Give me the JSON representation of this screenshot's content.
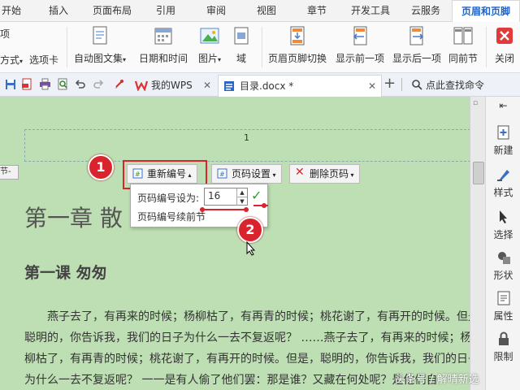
{
  "tabs": [
    "开始",
    "插入",
    "页面布局",
    "引用",
    "审阅",
    "视图",
    "章节",
    "开发工具",
    "云服务",
    "页眉和页脚"
  ],
  "active_tab": "页眉和页脚",
  "ribbon": {
    "left_partial_top": "项",
    "left_partial_bottom": "方式",
    "options_tab": "选项卡",
    "auto_text": "自动图文集",
    "date_time": "日期和时间",
    "picture": "图片",
    "field": "域",
    "switch_header_footer": "页眉页脚切换",
    "show_previous": "显示前一项",
    "show_next": "显示后一项",
    "same_as_previous": "同前节",
    "close": "关闭"
  },
  "quickbar": {
    "wps_tab": "我的WPS",
    "doc_tab": "目录.docx *",
    "search": "点此查找命令"
  },
  "document": {
    "page_number": "1",
    "section_label": "节-",
    "chapter_title": "第一章  散",
    "lesson_title": "第一课  匆匆",
    "para1": "燕子去了，有再来的时候；杨柳枯了，有再青的时候；桃花谢了，有再开的时候。但是",
    "para2": "聪明的，你告诉我，我们的日子为什么一去不复返呢？ ……燕子去了，有再来的时候；杨",
    "para3": "柳枯了，有再青的时候；桃花谢了，有再开的时候。但是，聪明的，你告诉我，我们的日子",
    "para4": "为什么一去不复返呢？ 一一是有人偷了他们罢：那是谁？又藏在何处呢？是他们自"
  },
  "header_toolbar": {
    "renumber": "重新编号",
    "page_settings": "页码设置",
    "delete_page_number": "删除页码"
  },
  "renumber_popup": {
    "label": "页码编号设为:",
    "value": "16",
    "continue_previous": "页码编号续前节"
  },
  "annotations": {
    "badge1": "1",
    "badge2": "2"
  },
  "right_panel": [
    "新建",
    "样式",
    "选择",
    "形状",
    "属性",
    "限制"
  ],
  "watermark": "头条号 / 解晴新选",
  "colors": {
    "doc_bg": "#bddfb3",
    "accent": "#1e63c9",
    "badge": "#d9232d",
    "ok_check": "#2e9d2e"
  }
}
